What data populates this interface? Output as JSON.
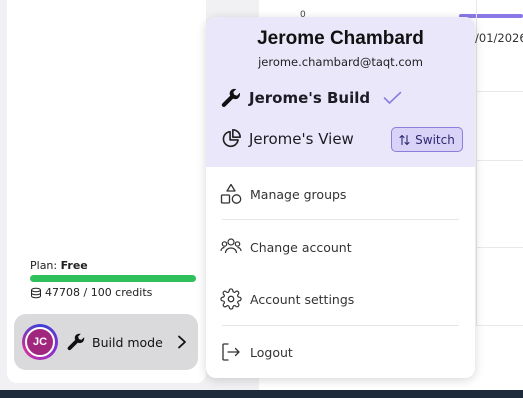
{
  "background": {
    "axis_tick": "0",
    "date_text": "/01/2026"
  },
  "sidebar": {
    "plan_label": "Plan:",
    "plan_value": "Free",
    "credits_text": "47708 / 100 credits",
    "credit_fill_fraction": 1.0,
    "mode_button": {
      "avatar_initials": "JC",
      "label": "Build mode"
    }
  },
  "user_menu": {
    "name": "Jerome Chambard",
    "email": "jerome.chambard@taqt.com",
    "workspaces": [
      {
        "label": "Jerome's Build",
        "icon": "wrench-icon",
        "active": true
      },
      {
        "label": "Jerome's View",
        "icon": "pie-chart-icon",
        "active": false
      }
    ],
    "switch_label": "Switch",
    "items": [
      {
        "label": "Manage groups",
        "icon": "shapes-icon"
      },
      {
        "label": "Change account",
        "icon": "users-icon"
      },
      {
        "label": "Account settings",
        "icon": "gear-icon"
      },
      {
        "label": "Logout",
        "icon": "logout-icon"
      }
    ]
  },
  "colors": {
    "menu_header_bg": "#ebe7fb",
    "accent": "#8a7fdc",
    "credit_bar": "#2fc05c",
    "avatar": "#a1267d"
  }
}
